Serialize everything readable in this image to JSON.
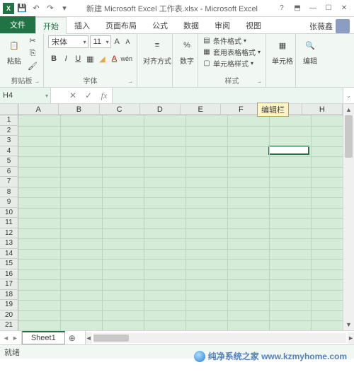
{
  "title": "新建 Microsoft Excel 工作表.xlsx - Microsoft Excel",
  "qat": {
    "save": "💾",
    "undo": "↶",
    "redo": "↷",
    "more": "▾"
  },
  "win": {
    "help": "?",
    "ribbon_opts": "⬒",
    "min": "—",
    "max": "☐",
    "close": "✕"
  },
  "tabs": {
    "file": "文件",
    "items": [
      "开始",
      "插入",
      "页面布局",
      "公式",
      "数据",
      "审阅",
      "视图"
    ]
  },
  "user": {
    "name": "张薇鑫"
  },
  "ribbon": {
    "clipboard": {
      "label": "剪贴板",
      "paste": "粘贴"
    },
    "font": {
      "label": "字体",
      "name": "宋体",
      "size": "11"
    },
    "alignment": {
      "label": "对齐方式"
    },
    "number": {
      "label": "数字"
    },
    "styles": {
      "label": "样式",
      "conditional": "条件格式",
      "table": "套用表格格式",
      "cell": "单元格样式"
    },
    "cells": {
      "label": "单元格"
    },
    "editing": {
      "label": "编辑"
    }
  },
  "formula_bar": {
    "name_box": "H4",
    "tooltip": "编辑栏"
  },
  "active_cell": {
    "col": 7,
    "row": 4
  },
  "columns": [
    "A",
    "B",
    "C",
    "D",
    "E",
    "F",
    "G",
    "H"
  ],
  "rows": [
    "1",
    "2",
    "3",
    "4",
    "5",
    "6",
    "7",
    "8",
    "9",
    "10",
    "11",
    "12",
    "13",
    "14",
    "15",
    "16",
    "17",
    "18",
    "19",
    "20",
    "21"
  ],
  "sheet": {
    "name": "Sheet1",
    "add": "⊕"
  },
  "status": {
    "ready": "就绪"
  },
  "watermark": "纯净系统之家 www.kzmyhome.com"
}
